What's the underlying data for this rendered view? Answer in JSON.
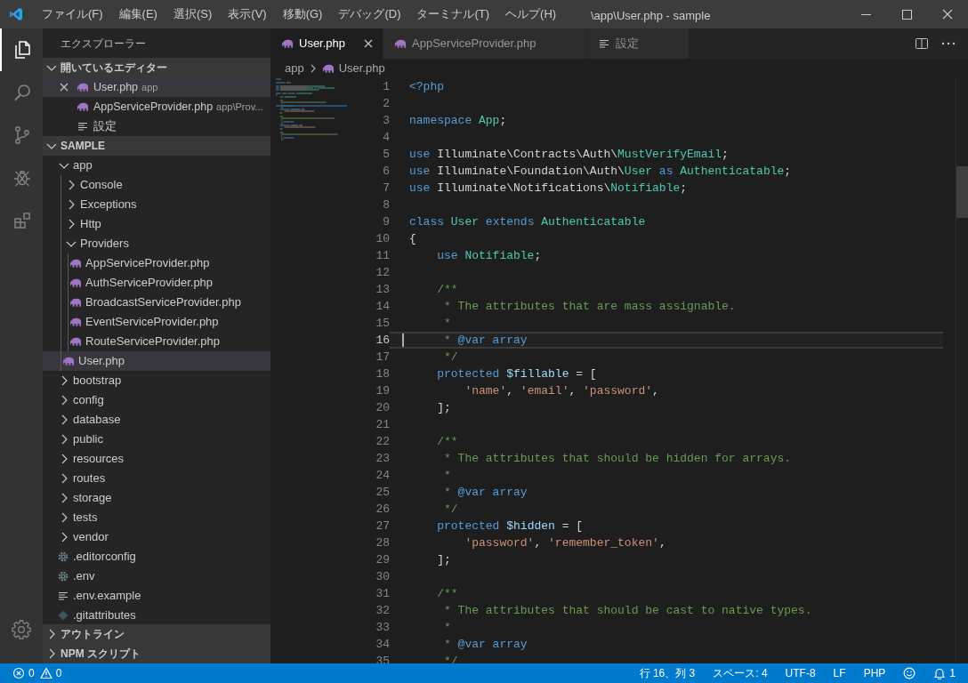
{
  "window": {
    "title": "\\app\\User.php - sample"
  },
  "menu": [
    "ファイル(F)",
    "編集(E)",
    "選択(S)",
    "表示(V)",
    "移動(G)",
    "デバッグ(D)",
    "ターミナル(T)",
    "ヘルプ(H)"
  ],
  "activity_bar": [
    {
      "kind": "explorer",
      "selected": true
    },
    {
      "kind": "search",
      "selected": false
    },
    {
      "kind": "scm",
      "selected": false
    },
    {
      "kind": "debug",
      "selected": false
    },
    {
      "kind": "extensions",
      "selected": false
    }
  ],
  "sidebar": {
    "title": "エクスプローラー",
    "open_editors": {
      "title": "開いているエディター",
      "expanded": true,
      "items": [
        {
          "name": "User.php",
          "description": "app",
          "kind": "php",
          "selected": true
        },
        {
          "name": "AppServiceProvider.php",
          "description": "app\\Prov...",
          "kind": "php",
          "selected": false
        },
        {
          "name": "設定",
          "kind": "settings",
          "selected": false
        }
      ]
    },
    "workspace": {
      "title": "SAMPLE",
      "expanded": true,
      "tree": [
        {
          "name": "app",
          "kind": "folder",
          "expanded": true,
          "selected": false,
          "children": [
            {
              "name": "Console",
              "kind": "folder",
              "expanded": false,
              "selected": false
            },
            {
              "name": "Exceptions",
              "kind": "folder",
              "expanded": false,
              "selected": false
            },
            {
              "name": "Http",
              "kind": "folder",
              "expanded": false,
              "selected": false
            },
            {
              "name": "Providers",
              "kind": "folder",
              "expanded": true,
              "selected": false,
              "children": [
                {
                  "name": "AppServiceProvider.php",
                  "kind": "php",
                  "selected": false
                },
                {
                  "name": "AuthServiceProvider.php",
                  "kind": "php",
                  "selected": false
                },
                {
                  "name": "BroadcastServiceProvider.php",
                  "kind": "php",
                  "selected": false
                },
                {
                  "name": "EventServiceProvider.php",
                  "kind": "php",
                  "selected": false
                },
                {
                  "name": "RouteServiceProvider.php",
                  "kind": "php",
                  "selected": false
                }
              ]
            },
            {
              "name": "User.php",
              "kind": "php",
              "selected": true
            }
          ]
        },
        {
          "name": "bootstrap",
          "kind": "folder",
          "expanded": false,
          "selected": false
        },
        {
          "name": "config",
          "kind": "folder",
          "expanded": false,
          "selected": false
        },
        {
          "name": "database",
          "kind": "folder",
          "expanded": false,
          "selected": false
        },
        {
          "name": "public",
          "kind": "folder",
          "expanded": false,
          "selected": false
        },
        {
          "name": "resources",
          "kind": "folder",
          "expanded": false,
          "selected": false
        },
        {
          "name": "routes",
          "kind": "folder",
          "expanded": false,
          "selected": false
        },
        {
          "name": "storage",
          "kind": "folder",
          "expanded": false,
          "selected": false
        },
        {
          "name": "tests",
          "kind": "folder",
          "expanded": false,
          "selected": false
        },
        {
          "name": "vendor",
          "kind": "folder",
          "expanded": false,
          "selected": false
        },
        {
          "name": ".editorconfig",
          "kind": "gear",
          "selected": false
        },
        {
          "name": ".env",
          "kind": "gear",
          "selected": false
        },
        {
          "name": ".env.example",
          "kind": "lines",
          "selected": false
        },
        {
          "name": ".gitattributes",
          "kind": "git",
          "selected": false
        }
      ]
    },
    "collapsed_sections": [
      {
        "title": "アウトライン",
        "expanded": false
      },
      {
        "title": "NPM スクリプト",
        "expanded": false
      }
    ]
  },
  "tabs": [
    {
      "label": "User.php",
      "kind": "php",
      "selected": true
    },
    {
      "label": "AppServiceProvider.php",
      "kind": "php",
      "selected": false
    },
    {
      "label": "設定",
      "kind": "settings",
      "selected": false
    }
  ],
  "breadcrumb": [
    {
      "label": "app",
      "kind": "folder"
    },
    {
      "label": "User.php",
      "kind": "php"
    }
  ],
  "code": [
    {
      "number": "1",
      "current": false,
      "tokens": [
        {
          "kind": "kw",
          "text": "<?php"
        }
      ]
    },
    {
      "number": "2",
      "current": false
    },
    {
      "number": "3",
      "current": false,
      "tokens": [
        {
          "kind": "kw",
          "text": "namespace"
        },
        {
          "kind": "cls",
          "text": " App"
        },
        {
          "kind": "plain",
          "text": ";"
        }
      ]
    },
    {
      "number": "4",
      "current": false
    },
    {
      "number": "5",
      "current": false,
      "tokens": [
        {
          "kind": "kw",
          "text": "use"
        },
        {
          "kind": "plain",
          "text": " Illuminate\\Contracts\\Auth\\"
        },
        {
          "kind": "cls",
          "text": "MustVerifyEmail"
        },
        {
          "kind": "plain",
          "text": ";"
        }
      ]
    },
    {
      "number": "6",
      "current": false,
      "tokens": [
        {
          "kind": "kw",
          "text": "use"
        },
        {
          "kind": "plain",
          "text": " Illuminate\\Foundation\\Auth\\"
        },
        {
          "kind": "cls",
          "text": "User"
        },
        {
          "kind": "kw",
          "text": " as"
        },
        {
          "kind": "cls",
          "text": " Authenticatable"
        },
        {
          "kind": "plain",
          "text": ";"
        }
      ]
    },
    {
      "number": "7",
      "current": false,
      "tokens": [
        {
          "kind": "kw",
          "text": "use"
        },
        {
          "kind": "plain",
          "text": " Illuminate\\Notifications\\"
        },
        {
          "kind": "cls",
          "text": "Notifiable"
        },
        {
          "kind": "plain",
          "text": ";"
        }
      ]
    },
    {
      "number": "8",
      "current": false
    },
    {
      "number": "9",
      "current": false,
      "tokens": [
        {
          "kind": "kw",
          "text": "class"
        },
        {
          "kind": "cls",
          "text": " User"
        },
        {
          "kind": "kw",
          "text": " extends"
        },
        {
          "kind": "cls",
          "text": " Authenticatable"
        }
      ]
    },
    {
      "number": "10",
      "current": false,
      "tokens": [
        {
          "kind": "plain",
          "text": "{"
        }
      ]
    },
    {
      "number": "11",
      "current": false,
      "tokens": [
        {
          "kind": "kw",
          "text": "    use"
        },
        {
          "kind": "cls",
          "text": " Notifiable"
        },
        {
          "kind": "plain",
          "text": ";"
        }
      ]
    },
    {
      "number": "12",
      "current": false
    },
    {
      "number": "13",
      "current": false,
      "tokens": [
        {
          "kind": "cm",
          "text": "    /**"
        }
      ]
    },
    {
      "number": "14",
      "current": false,
      "tokens": [
        {
          "kind": "cm",
          "text": "     * The attributes that are mass assignable."
        }
      ]
    },
    {
      "number": "15",
      "current": false,
      "tokens": [
        {
          "kind": "cm",
          "text": "     *"
        }
      ]
    },
    {
      "number": "16",
      "current": true,
      "tokens": [
        {
          "kind": "cm",
          "text": "     *"
        },
        {
          "kind": "kw",
          "text": " @var array"
        }
      ]
    },
    {
      "number": "17",
      "current": false,
      "tokens": [
        {
          "kind": "cm",
          "text": "     */"
        }
      ]
    },
    {
      "number": "18",
      "current": false,
      "tokens": [
        {
          "kind": "kw",
          "text": "    protected"
        },
        {
          "kind": "var",
          "text": " $fillable"
        },
        {
          "kind": "plain",
          "text": " = ["
        }
      ]
    },
    {
      "number": "19",
      "current": false,
      "tokens": [
        {
          "kind": "str",
          "text": "        'name'"
        },
        {
          "kind": "plain",
          "text": ", "
        },
        {
          "kind": "str",
          "text": "'email'"
        },
        {
          "kind": "plain",
          "text": ", "
        },
        {
          "kind": "str",
          "text": "'password'"
        },
        {
          "kind": "plain",
          "text": ","
        }
      ]
    },
    {
      "number": "20",
      "current": false,
      "tokens": [
        {
          "kind": "plain",
          "text": "    ];"
        }
      ]
    },
    {
      "number": "21",
      "current": false
    },
    {
      "number": "22",
      "current": false,
      "tokens": [
        {
          "kind": "cm",
          "text": "    /**"
        }
      ]
    },
    {
      "number": "23",
      "current": false,
      "tokens": [
        {
          "kind": "cm",
          "text": "     * The attributes that should be hidden for arrays."
        }
      ]
    },
    {
      "number": "24",
      "current": false,
      "tokens": [
        {
          "kind": "cm",
          "text": "     *"
        }
      ]
    },
    {
      "number": "25",
      "current": false,
      "tokens": [
        {
          "kind": "cm",
          "text": "     *"
        },
        {
          "kind": "kw",
          "text": " @var array"
        }
      ]
    },
    {
      "number": "26",
      "current": false,
      "tokens": [
        {
          "kind": "cm",
          "text": "     */"
        }
      ]
    },
    {
      "number": "27",
      "current": false,
      "tokens": [
        {
          "kind": "kw",
          "text": "    protected"
        },
        {
          "kind": "var",
          "text": " $hidden"
        },
        {
          "kind": "plain",
          "text": " = ["
        }
      ]
    },
    {
      "number": "28",
      "current": false,
      "tokens": [
        {
          "kind": "str",
          "text": "        'password'"
        },
        {
          "kind": "plain",
          "text": ", "
        },
        {
          "kind": "str",
          "text": "'remember_token'"
        },
        {
          "kind": "plain",
          "text": ","
        }
      ]
    },
    {
      "number": "29",
      "current": false,
      "tokens": [
        {
          "kind": "plain",
          "text": "    ];"
        }
      ]
    },
    {
      "number": "30",
      "current": false
    },
    {
      "number": "31",
      "current": false,
      "tokens": [
        {
          "kind": "cm",
          "text": "    /**"
        }
      ]
    },
    {
      "number": "32",
      "current": false,
      "tokens": [
        {
          "kind": "cm",
          "text": "     * The attributes that should be cast to native types."
        }
      ]
    },
    {
      "number": "33",
      "current": false,
      "tokens": [
        {
          "kind": "cm",
          "text": "     *"
        }
      ]
    },
    {
      "number": "34",
      "current": false,
      "tokens": [
        {
          "kind": "cm",
          "text": "     *"
        },
        {
          "kind": "kw",
          "text": " @var array"
        }
      ]
    },
    {
      "number": "35",
      "current": false,
      "tokens": [
        {
          "kind": "cm",
          "text": "     */"
        }
      ]
    }
  ],
  "status_bar": {
    "errors": "0",
    "warnings": "0",
    "items": [
      "行 16、列 3",
      "スペース: 4",
      "UTF-8",
      "LF",
      "PHP"
    ],
    "notifications": "1"
  }
}
